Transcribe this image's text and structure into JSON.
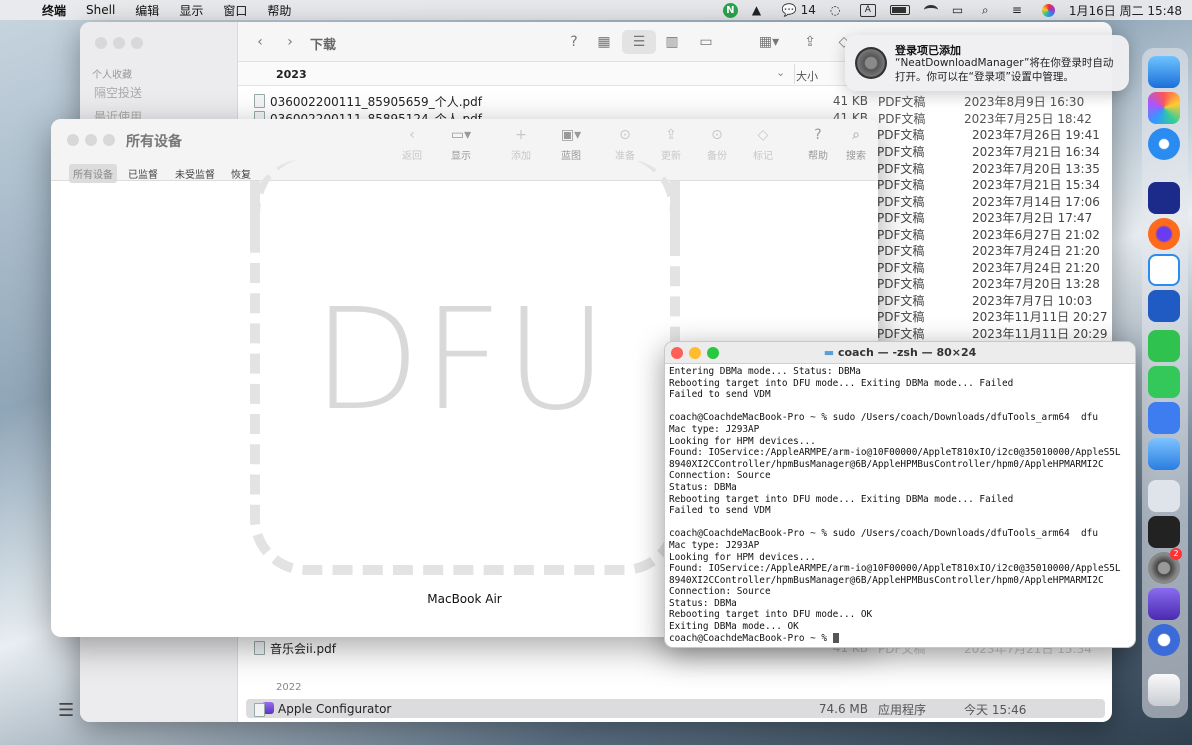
{
  "menubar": {
    "app": "终端",
    "items": [
      "Shell",
      "编辑",
      "显示",
      "窗口",
      "帮助"
    ],
    "wechat_count": "14",
    "input_letter": "A",
    "clock": "1月16日 周二  15:48",
    "badge_letter": "N"
  },
  "finder": {
    "title": "下载",
    "sidebar_section": "个人收藏",
    "sidebar_items": [
      "隔空投送",
      "最近使用"
    ],
    "group_2023": "2023",
    "col_size": "大小",
    "rows": [
      {
        "name": "036002200111_85905659_个人.pdf",
        "size": "41 KB",
        "kind": "PDF文稿",
        "date": "2023年8月9日 16:30"
      },
      {
        "name": "036002200111_85895124_个人.pdf",
        "size": "41 KB",
        "kind": "PDF文稿",
        "date": "2023年7月25日 18:42"
      }
    ],
    "visible_right": [
      {
        "kind": "PDF文稿",
        "date": "2023年7月26日 19:41"
      },
      {
        "kind": "PDF文稿",
        "date": "2023年7月21日 16:34"
      },
      {
        "kind": "PDF文稿",
        "date": "2023年7月20日 13:35"
      },
      {
        "kind": "PDF文稿",
        "date": "2023年7月21日 15:34"
      },
      {
        "kind": "PDF文稿",
        "date": "2023年7月14日 17:06"
      },
      {
        "kind": "PDF文稿",
        "date": "2023年7月2日 17:47"
      },
      {
        "kind": "PDF文稿",
        "date": "2023年6月27日 21:02"
      },
      {
        "kind": "PDF文稿",
        "date": "2023年7月24日 21:20"
      },
      {
        "kind": "PDF文稿",
        "date": "2023年7月24日 21:20"
      },
      {
        "kind": "PDF文稿",
        "date": "2023年7月20日 13:28"
      },
      {
        "kind": "PDF文稿",
        "date": "2023年7月7日 10:03"
      },
      {
        "kind": "PDF文稿",
        "date": "2023年11月11日 20:27"
      },
      {
        "kind": "PDF文稿",
        "date": "2023年11月11日 20:29"
      }
    ],
    "bottom_row": {
      "name": "音乐会ii.pdf",
      "size": "41 KB",
      "kind": "PDF文稿",
      "date": "2023年7月21日 15:34"
    },
    "group_2022": "2022",
    "app_row": {
      "name": "Apple Configurator",
      "size": "74.6 MB",
      "kind": "应用程序",
      "date": "今天 15:46"
    }
  },
  "configurator": {
    "title": "所有设备",
    "toolbar": [
      "返回",
      "显示",
      "添加",
      "蓝图",
      "准备",
      "更新",
      "备份",
      "标记",
      "帮助",
      "搜索"
    ],
    "segments": [
      "所有设备",
      "已监督",
      "未受监督",
      "恢复"
    ],
    "dfu_label": "DFU",
    "device_name": "MacBook Air"
  },
  "terminal": {
    "title": "coach — -zsh — 80×24",
    "lines": [
      "Entering DBMa mode... Status: DBMa",
      "Rebooting target into DFU mode... Exiting DBMa mode... Failed",
      "Failed to send VDM",
      "",
      "coach@CoachdeMacBook-Pro ~ % sudo /Users/coach/Downloads/dfuTools_arm64  dfu",
      "Mac type: J293AP",
      "Looking for HPM devices...",
      "Found: IOService:/AppleARMPE/arm-io@10F00000/AppleT810xIO/i2c0@35010000/AppleS5L",
      "8940XI2CController/hpmBusManager@6B/AppleHPMBusController/hpm0/AppleHPMARMI2C",
      "Connection: Source",
      "Status: DBMa",
      "Rebooting target into DFU mode... Exiting DBMa mode... Failed",
      "Failed to send VDM",
      "",
      "coach@CoachdeMacBook-Pro ~ % sudo /Users/coach/Downloads/dfuTools_arm64  dfu",
      "Mac type: J293AP",
      "Looking for HPM devices...",
      "Found: IOService:/AppleARMPE/arm-io@10F00000/AppleT810xIO/i2c0@35010000/AppleS5L",
      "8940XI2CController/hpmBusManager@6B/AppleHPMBusController/hpm0/AppleHPMARMI2C",
      "Connection: Source",
      "Status: DBMa",
      "Rebooting target into DFU mode... OK",
      "Exiting DBMa mode... OK"
    ],
    "prompt": "coach@CoachdeMacBook-Pro ~ % "
  },
  "notification": {
    "title": "登录项已添加",
    "body": "“NeatDownloadManager”将在你登录时自动打开。你可以在“登录项”设置中管理。"
  },
  "dock": {
    "badge": "2"
  }
}
